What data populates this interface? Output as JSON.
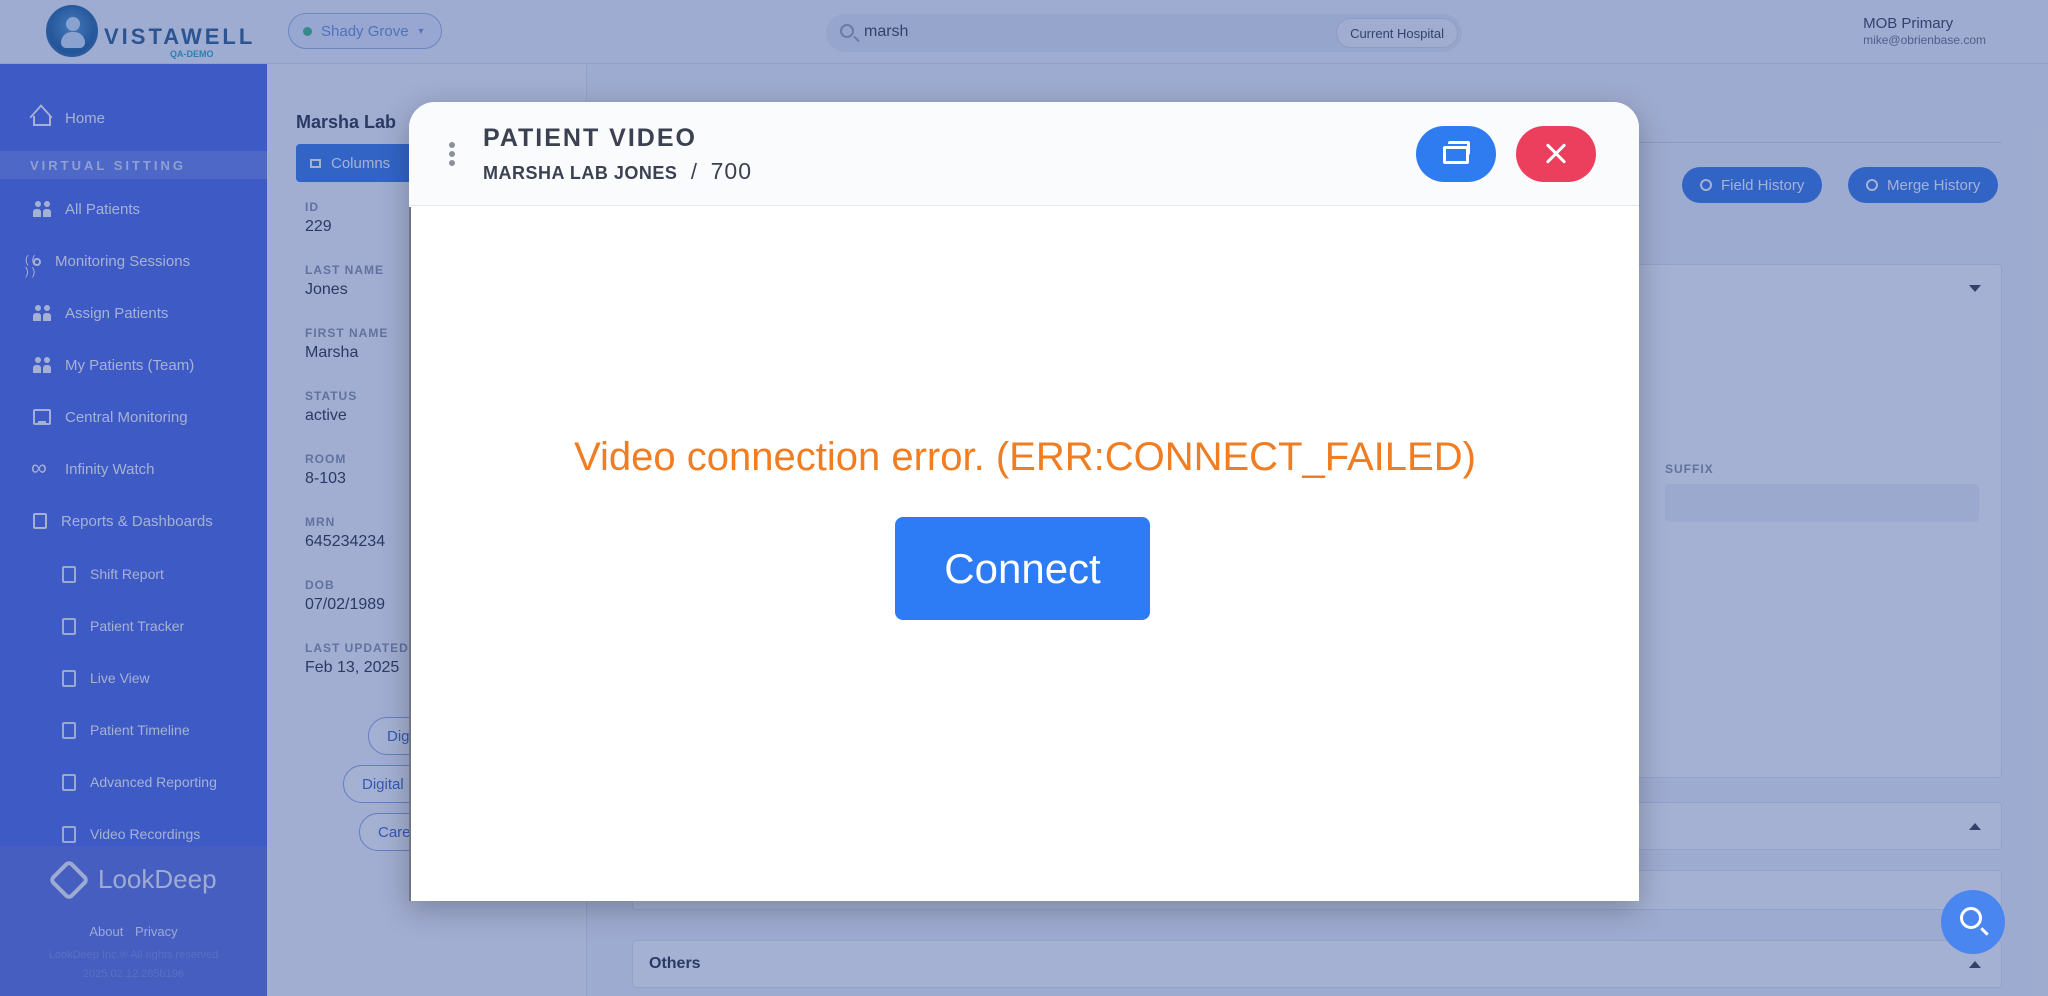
{
  "header": {
    "logo_text": "VISTAWELL",
    "logo_sub": "QA-DEMO",
    "location": "Shady Grove",
    "search_value": "marsh",
    "search_scope": "Current Hospital",
    "user_name": "MOB Primary",
    "user_email": "mike@obrienbase.com"
  },
  "sidebar": {
    "home": "Home",
    "section": "VIRTUAL SITTING",
    "items": [
      {
        "label": "All Patients",
        "icon": "people-icon"
      },
      {
        "label": "Monitoring Sessions",
        "icon": "signal-icon"
      },
      {
        "label": "Assign Patients",
        "icon": "group-icon"
      },
      {
        "label": "My Patients (Team)",
        "icon": "team-icon"
      },
      {
        "label": "Central Monitoring",
        "icon": "monitor-icon"
      },
      {
        "label": "Infinity Watch",
        "icon": "infinity-icon"
      },
      {
        "label": "Reports & Dashboards",
        "icon": "report-icon"
      }
    ],
    "subitems": [
      {
        "label": "Shift Report"
      },
      {
        "label": "Patient Tracker"
      },
      {
        "label": "Live View"
      },
      {
        "label": "Patient Timeline"
      },
      {
        "label": "Advanced Reporting"
      },
      {
        "label": "Video Recordings"
      }
    ],
    "footer": {
      "brand": "LookDeep",
      "about": "About",
      "privacy": "Privacy",
      "copyright": "LookDeep Inc.® All rights reserved",
      "version": "2025.02.12.285b196"
    }
  },
  "patient": {
    "title": "Marsha Lab",
    "columns_label": "Columns",
    "fields": [
      {
        "label": "ID",
        "value": "229"
      },
      {
        "label": "LAST NAME",
        "value": "Jones"
      },
      {
        "label": "FIRST NAME",
        "value": "Marsha"
      },
      {
        "label": "STATUS",
        "value": "active"
      },
      {
        "label": "ROOM",
        "value": "8-103"
      },
      {
        "label": "MRN",
        "value": "645234234"
      },
      {
        "label": "DOB",
        "value": "07/02/1989"
      },
      {
        "label": "LAST UPDATED",
        "value": "Feb 13, 2025"
      }
    ],
    "pills": [
      "Dig",
      "Digital",
      "Care"
    ]
  },
  "main": {
    "field_history": "Field History",
    "merge_history": "Merge History",
    "suffix_label": "SUFFIX",
    "others_label": "Others"
  },
  "modal": {
    "title": "PATIENT VIDEO",
    "patient_name": "MARSHA LAB JONES",
    "separator": "/",
    "room": "700",
    "error_message": "Video connection error. (ERR:CONNECT_FAILED)",
    "connect_label": "Connect"
  },
  "colors": {
    "sidebar": "#4e6ae6",
    "accent": "#2f7bf0",
    "close": "#ec3f5e",
    "error": "#f07d22"
  }
}
